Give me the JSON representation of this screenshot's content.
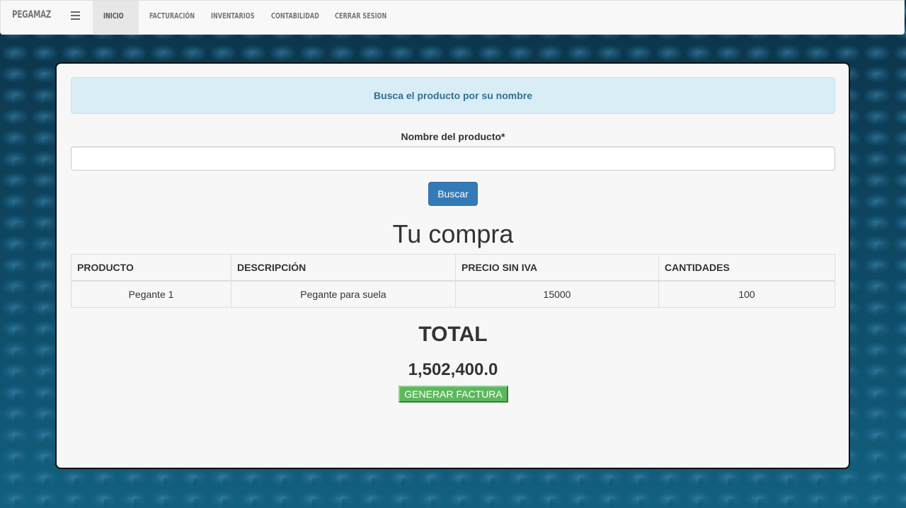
{
  "navbar": {
    "brand": "PEGAMAZ",
    "menu_icon": "hamburger-icon",
    "items": [
      {
        "label": "INICIO",
        "active": true
      },
      {
        "label": "FACTURACIÓN",
        "active": false
      },
      {
        "label": "INVENTARIOS",
        "active": false
      },
      {
        "label": "CONTABILIDAD",
        "active": false
      },
      {
        "label": "CERRAR SESION",
        "active": false
      }
    ]
  },
  "search": {
    "alert": "Busca el producto por su nombre",
    "label": "Nombre del producto*",
    "value": "",
    "placeholder": "",
    "button": "Buscar"
  },
  "purchase": {
    "title": "Tu compra",
    "columns": [
      "PRODUCTO",
      "DESCRIPCIÓN",
      "PRECIO SIN IVA",
      "CANTIDADES"
    ],
    "rows": [
      [
        "Pegante 1",
        "Pegante para suela",
        "15000",
        "100"
      ]
    ]
  },
  "total": {
    "title": "TOTAL",
    "value": "1,502,400.0",
    "button": "GENERAR FACTURA"
  },
  "colors": {
    "primary": "#337ab7",
    "success": "#5cb85c",
    "info_bg": "#d9edf7",
    "info_text": "#31708f"
  }
}
